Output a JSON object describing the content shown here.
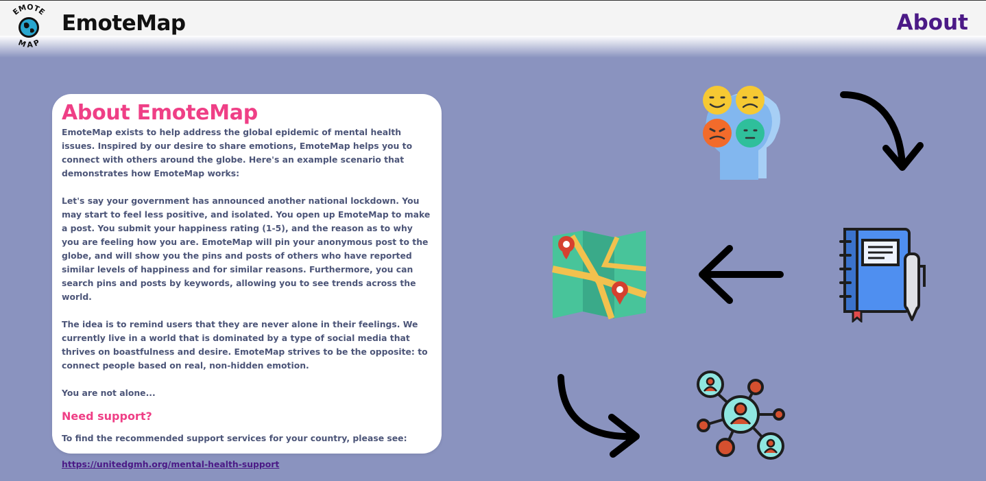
{
  "header": {
    "logo_alt": "EmoteMap globe logo",
    "logo_top_text": "EMOTE",
    "logo_bottom_text": "MAP",
    "brand": "EmoteMap",
    "nav_about": "About"
  },
  "card": {
    "title": "About EmoteMap",
    "paragraphs": [
      "EmoteMap exists to help address the global epidemic of mental health issues. Inspired by our desire to share emotions, EmoteMap helps you to connect with others around the globe. Here's an example scenario that demonstrates how EmoteMap works:",
      "Let's say your government has announced another national lockdown. You may start to feel less positive, and isolated. You open up EmoteMap to make a post. You submit your happiness rating (1-5), and the reason as to why you are feeling how you are. EmoteMap will pin your anonymous post to the globe, and will show you the pins and posts of others who have reported similar levels of happiness and for similar reasons. Furthermore, you can search pins and posts by keywords, allowing you to see trends across the world.",
      "The idea is to remind users that they are never alone in their feelings. We currently live in a world that is dominated by a type of social media that thrives on boastfulness and desire. EmoteMap strives to be the opposite: to connect people based on real, non-hidden emotion.",
      "You are not alone..."
    ],
    "support_heading": "Need support?",
    "support_text": "To find the recommended support services for your country, please see:",
    "support_link": "https://unitedgmh.org/mental-health-support"
  },
  "icons": [
    "emotions-heads-icon",
    "curved-arrow-down-icon",
    "notebook-icon",
    "arrow-left-icon",
    "map-pins-icon",
    "curved-arrow-right-icon",
    "people-network-icon"
  ],
  "colors": {
    "background": "#8a93bf",
    "title_pink": "#ef3f86",
    "nav_purple": "#4b1a86",
    "body_text": "#4c5578"
  }
}
